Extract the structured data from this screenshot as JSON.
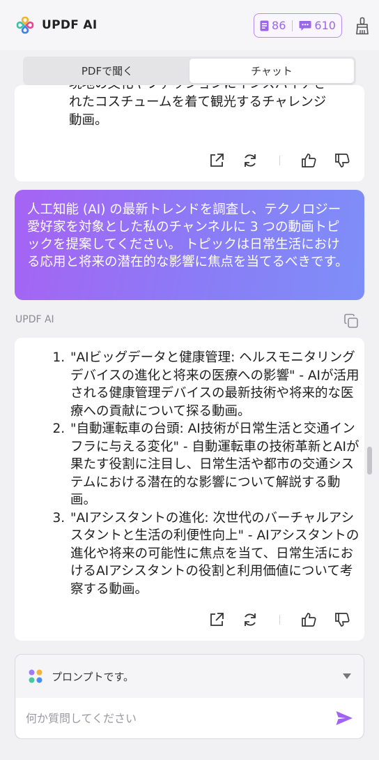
{
  "header": {
    "title": "UPDF AI",
    "quota": {
      "docs": "86",
      "chats": "610"
    }
  },
  "tabs": [
    {
      "label": "PDFで聞く",
      "active": false
    },
    {
      "label": "チャット",
      "active": true
    }
  ],
  "previous_response": {
    "cut_line": "現地の文化やファッションにインスパイアさ",
    "lines": [
      "れたコスチュームを着て観光するチャレンジ",
      "動画。"
    ]
  },
  "user_message": "人工知能 (AI) の最新トレンドを調査し、テクノロジー愛好家を対象とした私のチャンネルに 3 つの動画トピックを提案してください。 トピックは日常生活における応用と将来の潜在的な影響に焦点を当てるべきです。",
  "ai": {
    "label": "UPDF AI",
    "items": [
      "\"AIビッグデータと健康管理: ヘルスモニタリングデバイスの進化と将来の医療への影響\" - AIが活用される健康管理デバイスの最新技術や将来的な医療への貢献について探る動画。",
      "\"自動運転車の台頭: AI技術が日常生活と交通インフラに与える変化\" - 自動運転車の技術革新とAIが果たす役割に注目し、日常生活や都市の交通システムにおける潜在的な影響について解説する動画。",
      "\"AIアシスタントの進化: 次世代のバーチャルアシスタントと生活の利便性向上\" - AIアシスタントの進化や将来の可能性に焦点を当て、日常生活におけるAIアシスタントの役割と利用価値について考察する動画。"
    ]
  },
  "composer": {
    "prompt_label": "プロンプトです。",
    "placeholder": "何か質問してください"
  },
  "colors": {
    "accent": "#9b66ee",
    "bubble_start": "#a663f4",
    "bubble_end": "#7e8ff8"
  }
}
